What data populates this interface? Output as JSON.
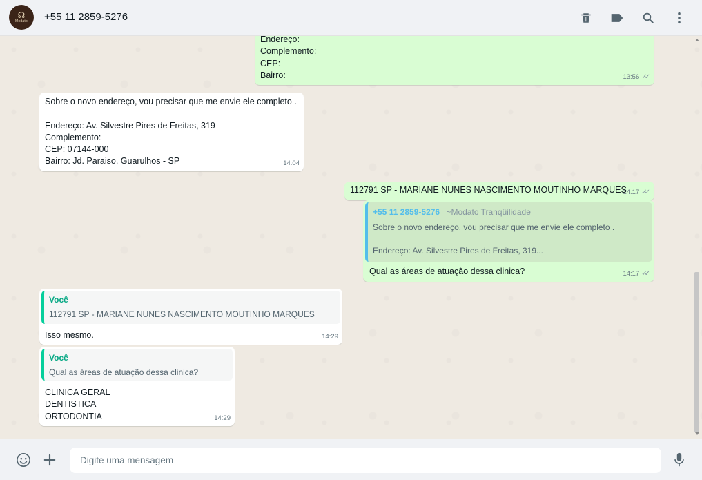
{
  "header": {
    "contact": "+55 11 2859-5276",
    "avatar_logo_text": "Modato",
    "icons": [
      "delete-icon",
      "label-icon",
      "search-icon",
      "more-vertical-icon"
    ]
  },
  "messages": [
    {
      "direction": "out",
      "text": "Endereço:\nComplemento:\nCEP:\nBairro:",
      "time": "13:56",
      "status": "read"
    },
    {
      "direction": "in",
      "text": "Sobre o novo endereço, vou precisar que me envie ele completo .\n\nEndereço: Av. Silvestre Pires de Freitas, 319\nComplemento:\nCEP: 07144-000\nBairro: Jd. Paraiso, Guarulhos - SP",
      "time": "14:04"
    },
    {
      "direction": "out",
      "text": "112791 SP - MARIANE NUNES NASCIMENTO MOUTINHO MARQUES",
      "time": "14:17",
      "status": "read"
    },
    {
      "direction": "out",
      "quote": {
        "author": "+55 11 2859-5276",
        "alias": "~Modato Tranqüilidade",
        "text": "Sobre o novo endereço, vou precisar que me envie ele completo .\n\nEndereço: Av. Silvestre Pires de Freitas, 319..."
      },
      "text": "Qual as áreas de atuação dessa clinica?",
      "time": "14:17",
      "status": "read"
    },
    {
      "direction": "in",
      "quote": {
        "author": "Você",
        "text": "112791 SP - MARIANE NUNES NASCIMENTO MOUTINHO MARQUES"
      },
      "text": "Isso mesmo.",
      "time": "14:29"
    },
    {
      "direction": "in",
      "quote": {
        "author": "Você",
        "text": "Qual as áreas de atuação dessa clinica?"
      },
      "text": "CLINICA GERAL\nDENTISTICA\nORTODONTIA",
      "time": "14:29"
    }
  ],
  "footer": {
    "placeholder": "Digite uma mensagem",
    "icons": [
      "emoji-icon",
      "plus-icon",
      "microphone-icon"
    ]
  },
  "colors": {
    "incoming_bubble": "#ffffff",
    "outgoing_bubble": "#d9fdd3",
    "chat_background": "#efeae2",
    "quote_accent": "#06cf9c"
  }
}
